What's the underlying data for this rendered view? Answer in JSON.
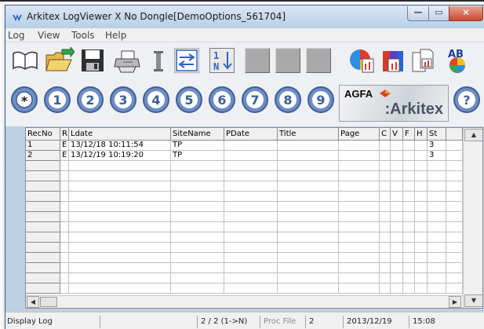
{
  "window": {
    "title": "Arkitex LogViewer X No Dongle[DemoOptions_561704]",
    "minimize_glyph": "—",
    "maximize_glyph": "▭",
    "close_glyph": "✕"
  },
  "menu": {
    "items": [
      "Log",
      "View",
      "Tools",
      "Help"
    ]
  },
  "toolbar1": {
    "icons": [
      "open-book-icon",
      "open-folder-icon",
      "save-disk-icon",
      "print-icon",
      "separator-icon",
      "swap-arrows-icon",
      "sort-1-n-icon",
      "tool-slot-1",
      "tool-slot-2",
      "tool-slot-3",
      "color-globe-icon",
      "color-chart-icon",
      "copy-page-icon",
      "spell-check-icon"
    ],
    "sort_label": "1N",
    "spell_label": "AB"
  },
  "toolbar2": {
    "number_buttons": [
      "*",
      "1",
      "2",
      "3",
      "4",
      "5",
      "6",
      "7",
      "8",
      "9"
    ],
    "help_label": "?",
    "logo": {
      "brand": "AGFA",
      "product": ":Arkitex"
    }
  },
  "colors": {
    "number_button": "#6f8ec2",
    "number_button_dark": "#3f5f99",
    "accent_blue": "#2e61c6",
    "title_bar": "#c2d5ea"
  },
  "grid": {
    "columns": [
      "RecNo",
      "R",
      "Ldate",
      "SiteName",
      "PDate",
      "Title",
      "Page",
      "C",
      "V",
      "F",
      "H",
      "St"
    ],
    "rows": [
      [
        "1",
        "E",
        "13/12/18 10:11:54",
        "TP",
        "",
        "",
        "",
        "",
        "",
        "",
        "",
        "3"
      ],
      [
        "2",
        "E",
        "13/12/19 10:19:20",
        "TP",
        "",
        "",
        "",
        "",
        "",
        "",
        "",
        "3"
      ]
    ],
    "empty_rows": 13,
    "scroll": {
      "up": "▲",
      "down": "▼",
      "left": "◀",
      "right": "▶"
    }
  },
  "statusbar": {
    "mode": "Display Log",
    "count": "2 / 2 (1->N)",
    "proc_label": "Proc File",
    "proc_value": "2",
    "date": "2013/12/19",
    "time": "15:08"
  }
}
